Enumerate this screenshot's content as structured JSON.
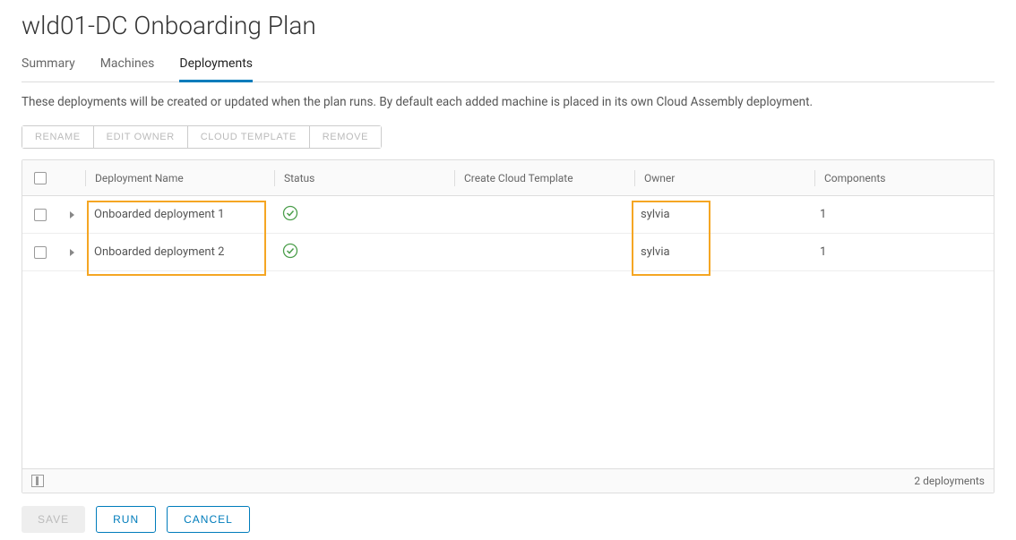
{
  "pageTitle": "wld01-DC Onboarding Plan",
  "tabs": [
    {
      "label": "Summary",
      "active": false
    },
    {
      "label": "Machines",
      "active": false
    },
    {
      "label": "Deployments",
      "active": true
    }
  ],
  "description": "These deployments will be created or updated when the plan runs. By default each added machine is placed in its own Cloud Assembly deployment.",
  "toolbar": {
    "rename": "RENAME",
    "editOwner": "EDIT OWNER",
    "cloudTemplate": "CLOUD TEMPLATE",
    "remove": "REMOVE"
  },
  "columns": {
    "name": "Deployment Name",
    "status": "Status",
    "template": "Create Cloud Template",
    "owner": "Owner",
    "components": "Components"
  },
  "rows": [
    {
      "name": "Onboarded deployment 1",
      "status": "ok",
      "template": "",
      "owner": "sylvia",
      "components": "1"
    },
    {
      "name": "Onboarded deployment 2",
      "status": "ok",
      "template": "",
      "owner": "sylvia",
      "components": "1"
    }
  ],
  "footer": {
    "count": "2 deployments"
  },
  "actions": {
    "save": "SAVE",
    "run": "RUN",
    "cancel": "CANCEL"
  }
}
